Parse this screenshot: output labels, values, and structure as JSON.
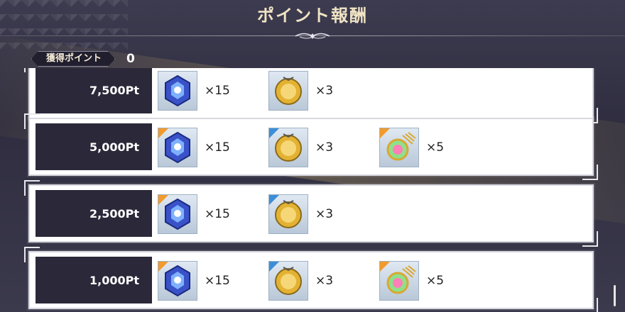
{
  "header": {
    "title": "ポイント報酬"
  },
  "points": {
    "label": "獲得ポイント",
    "value": "0"
  },
  "rewards": [
    {
      "threshold": "7,500Pt",
      "items": [
        {
          "icon": "crystal-icon",
          "qty": "×15"
        },
        {
          "icon": "gold-medal-icon",
          "qty": "×3"
        }
      ]
    },
    {
      "threshold": "5,000Pt",
      "items": [
        {
          "icon": "crystal-icon",
          "qty": "×15"
        },
        {
          "icon": "gold-medal-icon",
          "qty": "×3"
        },
        {
          "icon": "rainbow-crest-icon",
          "qty": "×5"
        }
      ]
    },
    {
      "threshold": "2,500Pt",
      "items": [
        {
          "icon": "crystal-icon",
          "qty": "×15"
        },
        {
          "icon": "gold-medal-icon",
          "qty": "×3"
        }
      ]
    },
    {
      "threshold": "1,000Pt",
      "items": [
        {
          "icon": "crystal-icon",
          "qty": "×15"
        },
        {
          "icon": "gold-medal-icon",
          "qty": "×3"
        },
        {
          "icon": "rainbow-crest-icon",
          "qty": "×5"
        }
      ]
    }
  ],
  "colors": {
    "accent": "#f29a2c",
    "label_bg": "#2b2839",
    "title": "#efe3c4"
  }
}
